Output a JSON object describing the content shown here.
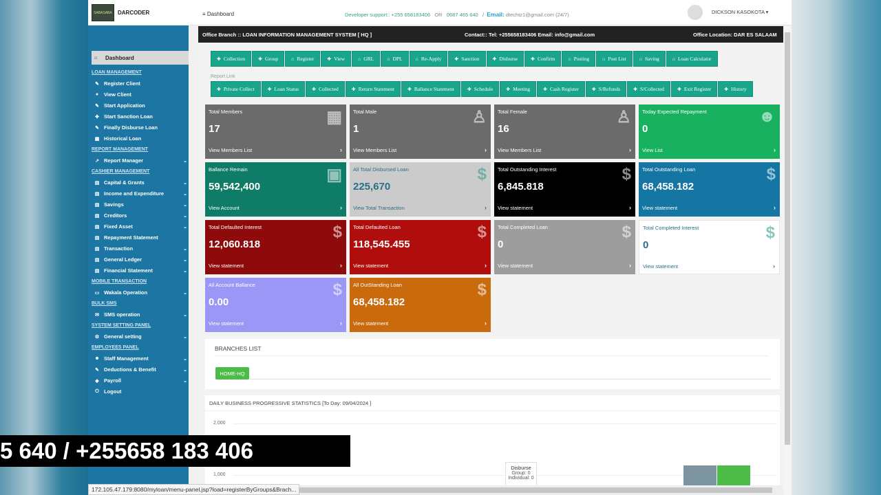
{
  "brand": {
    "logo_text": "SABASABA",
    "name": "DARCODER"
  },
  "topbar": {
    "breadcrumb": "Dashboard",
    "support_label": "Developer support:: +255 658183406",
    "support_or": "OR",
    "support_alt": "0687 465 640",
    "email_label": "Email:",
    "email": "dtechtz1@gmail.com",
    "hours": "(24/7)",
    "user": "DICKSON   KASOKOTA ▾"
  },
  "infobar": {
    "branch": "Office Branch :: LOAN INFORMATION MANAGEMENT SYSTEM  [ HQ ]",
    "contact": "Contact:: Tel:  +255658183406  Email:  info@gmail.com",
    "location": "Office Location: DAR ES SALAAM"
  },
  "sidebar": {
    "dashboard": "Dashboard",
    "sections": [
      {
        "title": "LOAN MANAGEMENT",
        "items": [
          {
            "label": "Register Client",
            "icon": "✎",
            "chev": false
          },
          {
            "label": "View Client",
            "icon": "●",
            "chev": false
          },
          {
            "label": "Start Application",
            "icon": "✎",
            "chev": false
          },
          {
            "label": "Start Sanction Loan",
            "icon": "✚",
            "chev": false
          },
          {
            "label": "Finally Disburse Loan",
            "icon": "✎",
            "chev": false
          },
          {
            "label": "Historical Loan",
            "icon": "▦",
            "chev": false
          }
        ]
      },
      {
        "title": "REPORT MANAGEMENT",
        "items": [
          {
            "label": "Report Manager",
            "icon": "↗",
            "chev": true
          }
        ]
      },
      {
        "title": "CASHIER MANAGEMENT",
        "items": [
          {
            "label": "Capital & Grants",
            "icon": "▤",
            "chev": true
          },
          {
            "label": "Income and Expenditure",
            "icon": "▤",
            "chev": true
          },
          {
            "label": "Savings",
            "icon": "▤",
            "chev": true
          },
          {
            "label": "Creditors",
            "icon": "▤",
            "chev": true
          },
          {
            "label": "Fixed Asset",
            "icon": "▤",
            "chev": true
          },
          {
            "label": "Repayment Statement",
            "icon": "▤",
            "chev": false
          },
          {
            "label": "Transaction",
            "icon": "▤",
            "chev": true
          },
          {
            "label": "General Ledger",
            "icon": "▤",
            "chev": true
          },
          {
            "label": "Financial Statement",
            "icon": "▤",
            "chev": true
          }
        ]
      },
      {
        "title": "MOBILE TRANSACTION",
        "items": [
          {
            "label": "Wakala Operation",
            "icon": "▭",
            "chev": true
          }
        ]
      },
      {
        "title": "BULK SMS",
        "items": [
          {
            "label": "SMS operation",
            "icon": "✉",
            "chev": true
          }
        ]
      },
      {
        "title": "SYSTEM SETTING PANEL",
        "items": [
          {
            "label": "General setting",
            "icon": "⚙",
            "chev": true
          }
        ]
      },
      {
        "title": "EMPLOYEES PANEL",
        "items": [
          {
            "label": "Staff Management",
            "icon": "☻",
            "chev": true
          },
          {
            "label": "Deductions & Benefit",
            "icon": "✎",
            "chev": true
          },
          {
            "label": "Payroll",
            "icon": "◆",
            "chev": true
          },
          {
            "label": "Logout",
            "icon": "⏻",
            "chev": false
          }
        ]
      }
    ]
  },
  "toolbar_top": [
    {
      "icon": "✚",
      "label": "Collection"
    },
    {
      "icon": "✚",
      "label": "Group"
    },
    {
      "icon": "⌂",
      "label": "Register"
    },
    {
      "icon": "✚",
      "label": "View"
    },
    {
      "icon": "⌂",
      "label": "GRL"
    },
    {
      "icon": "⌂",
      "label": "DPL"
    },
    {
      "icon": "⌂",
      "label": "Re-Apply"
    },
    {
      "icon": "✚",
      "label": "Sanction"
    },
    {
      "icon": "✚",
      "label": "Disburse"
    },
    {
      "icon": "✚",
      "label": "Confirm"
    },
    {
      "icon": "⌂",
      "label": "Posting"
    },
    {
      "icon": "⌂",
      "label": "Post List"
    },
    {
      "icon": "⌂",
      "label": "Saving"
    },
    {
      "icon": "⌂",
      "label": "Loan Calculator"
    }
  ],
  "report_label": "Report Link",
  "toolbar_report": [
    {
      "icon": "✚",
      "label": "Private Collect"
    },
    {
      "icon": "✚",
      "label": "Loan Status"
    },
    {
      "icon": "✚",
      "label": "Collected"
    },
    {
      "icon": "✚",
      "label": "Return Statement"
    },
    {
      "icon": "✚",
      "label": "Ballance Statement"
    },
    {
      "icon": "✚",
      "label": "Schedule"
    },
    {
      "icon": "✚",
      "label": "Meeting"
    },
    {
      "icon": "✚",
      "label": "Cash Register"
    },
    {
      "icon": "✚",
      "label": "S/Refunds"
    },
    {
      "icon": "✚",
      "label": "S/Collected"
    },
    {
      "icon": "✚",
      "label": "Exit Register"
    },
    {
      "icon": "✚",
      "label": "History"
    }
  ],
  "tiles": [
    {
      "label": "Total Members",
      "value": "17",
      "footer": "View Members List",
      "color": "#6b6b6b",
      "icon": "▦",
      "dark": false
    },
    {
      "label": "Total Male",
      "value": "1",
      "footer": "View Members List",
      "color": "#6b6b6b",
      "icon": "♙",
      "dark": false
    },
    {
      "label": "Total Female",
      "value": "16",
      "footer": "View Members List",
      "color": "#6b6b6b",
      "icon": "♙",
      "dark": false
    },
    {
      "label": "Today Expected Repayment",
      "value": "0",
      "footer": "View List",
      "color": "#17b15f",
      "icon": "☻",
      "dark": false
    },
    {
      "label": "Ballance Remain",
      "value": "59,542,400",
      "footer": "View Account",
      "color": "#0e7c66",
      "icon": "▣",
      "dark": false
    },
    {
      "label": "All Total Disbursed Loan",
      "value": "225,670",
      "footer": "View Total Transaction",
      "color": "#cbcbcb",
      "icon": "$",
      "dark": true
    },
    {
      "label": "Total Outstanding Interest",
      "value": "6,845.818",
      "footer": "View statement",
      "color": "#000000",
      "icon": "$",
      "dark": false
    },
    {
      "label": "Total Outstanding Loan",
      "value": "68,458.182",
      "footer": "View statement",
      "color": "#1576a4",
      "icon": "$",
      "dark": false
    },
    {
      "label": "Total Defaulted Interest",
      "value": "12,060.818",
      "footer": "View statement",
      "color": "#8f0b0b",
      "icon": "$",
      "dark": false
    },
    {
      "label": "Total Defaulted Loan",
      "value": "118,545.455",
      "footer": "View statement",
      "color": "#b00d0d",
      "icon": "$",
      "dark": false
    },
    {
      "label": "Total Completed Loan",
      "value": "0",
      "footer": "View statement",
      "color": "#9d9d9d",
      "icon": "$",
      "dark": false
    },
    {
      "label": "Total Completed Interest",
      "value": "0",
      "footer": "View statement",
      "color": "#ffffff",
      "icon": "$",
      "dark": true
    },
    {
      "label": "All Account Ballance",
      "value": "0.00",
      "footer": "View statement",
      "color": "#9b97f7",
      "icon": "$",
      "dark": false
    },
    {
      "label": "All OutStanding Loan",
      "value": "68,458.182",
      "footer": "View statement",
      "color": "#c96a0d",
      "icon": "$",
      "dark": false
    }
  ],
  "branches": {
    "title": "BRANCHES LIST",
    "button": "HOME-HQ"
  },
  "stats": {
    "title": "DAILY BUSINESS PROGRESSIVE STATISTICS [To Day: 09/04/2024 ]",
    "y_labels": [
      "2,000",
      "1,000"
    ]
  },
  "chart_data": {
    "type": "bar",
    "title": "DAILY BUSINESS PROGRESSIVE STATISTICS [To Day: 09/04/2024 ]",
    "y_ticks": [
      2000,
      1000
    ],
    "tooltip": {
      "title": "Disburse",
      "lines": [
        "Group: 0",
        "Individual: 0"
      ]
    },
    "series_colors": [
      "#7d95a1",
      "#4cbb47"
    ]
  },
  "tooltip": {
    "title": "Disburse",
    "group": "Group: 0",
    "individual": "Individual: 0"
  },
  "status_url": "172.105.47.179:8080/myloan/menu-panel.jsp?load=registerByGroups&Brach...",
  "phone_banner": "5 640 / +255658 183 406"
}
